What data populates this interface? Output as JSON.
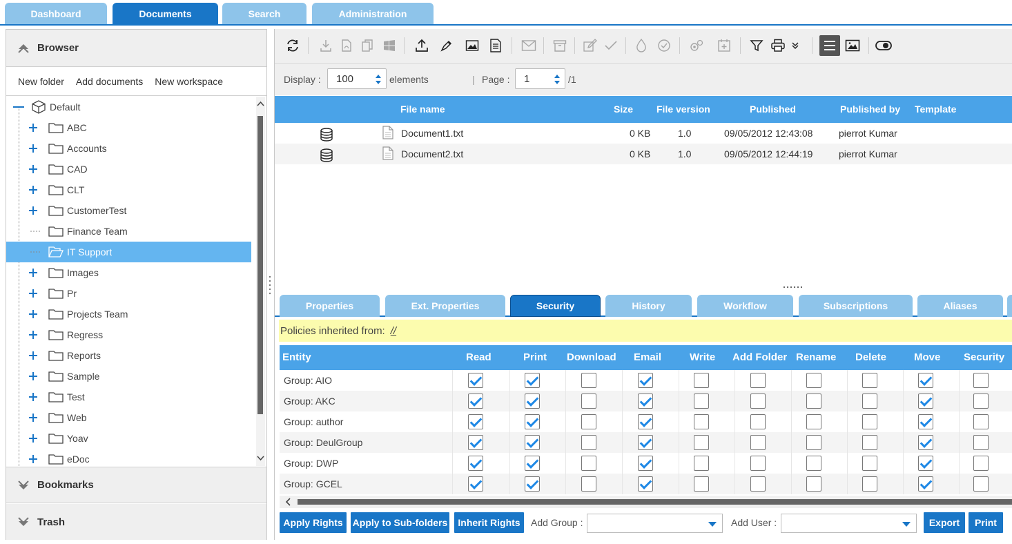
{
  "top_tabs": [
    {
      "label": "Dashboard",
      "active": false
    },
    {
      "label": "Documents",
      "active": true
    },
    {
      "label": "Search",
      "active": false
    },
    {
      "label": "Administration",
      "active": false
    }
  ],
  "left": {
    "browser_title": "Browser",
    "actions": {
      "new_folder": "New folder",
      "add_documents": "Add documents",
      "new_workspace": "New workspace"
    },
    "tree_root": "Default",
    "tree_items": [
      "ABC",
      "Accounts",
      "CAD",
      "CLT",
      "CustomerTest",
      "Finance Team",
      "IT Support",
      "Images",
      "Pr",
      "Projects Team",
      "Regress",
      "Reports",
      "Sample",
      "Test",
      "Web",
      "Yoav",
      "eDoc"
    ],
    "selected_item": "IT Support",
    "bookmarks_title": "Bookmarks",
    "trash_title": "Trash"
  },
  "toolbar": {
    "icons": [
      "refresh-icon",
      "download-icon",
      "pdf-icon",
      "copy-icon",
      "windows-icon",
      "upload-icon",
      "pen-icon",
      "image-icon",
      "document-icon",
      "mail-icon",
      "archive-icon",
      "edit-icon",
      "check-icon",
      "drop-icon",
      "approve-icon",
      "settings-icon",
      "calendar-add-icon",
      "filter-icon",
      "print-icon",
      "chevron-down-icon",
      "list-view-icon",
      "thumbnail-view-icon",
      "eye-icon"
    ]
  },
  "display": {
    "display_label": "Display :",
    "display_value": "100",
    "elements_label": "elements",
    "separator": "|",
    "page_label": "Page :",
    "page_value": "1",
    "page_total": "/1"
  },
  "files": {
    "headers": {
      "file_name": "File name",
      "size": "Size",
      "version": "File version",
      "published": "Published",
      "published_by": "Published by",
      "template": "Template"
    },
    "rows": [
      {
        "name": "Document1.txt",
        "size": "0 KB",
        "version": "1.0",
        "published": "09/05/2012 12:43:08",
        "published_by": "pierrot Kumar",
        "template": ""
      },
      {
        "name": "Document2.txt",
        "size": "0 KB",
        "version": "1.0",
        "published": "09/05/2012 12:44:19",
        "published_by": "pierrot Kumar",
        "template": ""
      }
    ]
  },
  "bottom_tabs": [
    {
      "label": "Properties",
      "active": false
    },
    {
      "label": "Ext. Properties",
      "active": false
    },
    {
      "label": "Security",
      "active": true
    },
    {
      "label": "History",
      "active": false
    },
    {
      "label": "Workflow",
      "active": false
    },
    {
      "label": "Subscriptions",
      "active": false
    },
    {
      "label": "Aliases",
      "active": false
    }
  ],
  "security": {
    "inherited_label": "Policies inherited from:",
    "inherited_link": "//",
    "headers": [
      "Entity",
      "Read",
      "Print",
      "Download",
      "Email",
      "Write",
      "Add Folder",
      "Rename",
      "Delete",
      "Move",
      "Security"
    ],
    "rows": [
      {
        "entity": "Group: AIO",
        "rights": [
          true,
          true,
          false,
          true,
          false,
          false,
          false,
          false,
          true,
          false
        ]
      },
      {
        "entity": "Group: AKC",
        "rights": [
          true,
          true,
          false,
          true,
          false,
          false,
          false,
          false,
          true,
          false
        ]
      },
      {
        "entity": "Group: author",
        "rights": [
          true,
          true,
          false,
          true,
          false,
          false,
          false,
          false,
          true,
          false
        ]
      },
      {
        "entity": "Group: DeulGroup",
        "rights": [
          true,
          true,
          false,
          true,
          false,
          false,
          false,
          false,
          true,
          false
        ]
      },
      {
        "entity": "Group: DWP",
        "rights": [
          true,
          true,
          false,
          true,
          false,
          false,
          false,
          false,
          true,
          false
        ]
      },
      {
        "entity": "Group: GCEL",
        "rights": [
          true,
          true,
          false,
          true,
          false,
          false,
          false,
          false,
          true,
          false
        ]
      }
    ]
  },
  "bottom_bar": {
    "apply_rights": "Apply Rights",
    "apply_subfolders": "Apply to Sub-folders",
    "inherit_rights": "Inherit Rights",
    "add_group_label": "Add Group :",
    "add_group_value": "",
    "add_user_label": "Add User :",
    "add_user_value": "",
    "export": "Export",
    "print": "Print"
  },
  "colors": {
    "accent": "#1976c7",
    "header": "#4aa3e8",
    "selected": "#64b5f0",
    "tab_inactive": "#8ec4ea",
    "inherit_bar": "#fcfcae",
    "check": "#1e88e5"
  }
}
